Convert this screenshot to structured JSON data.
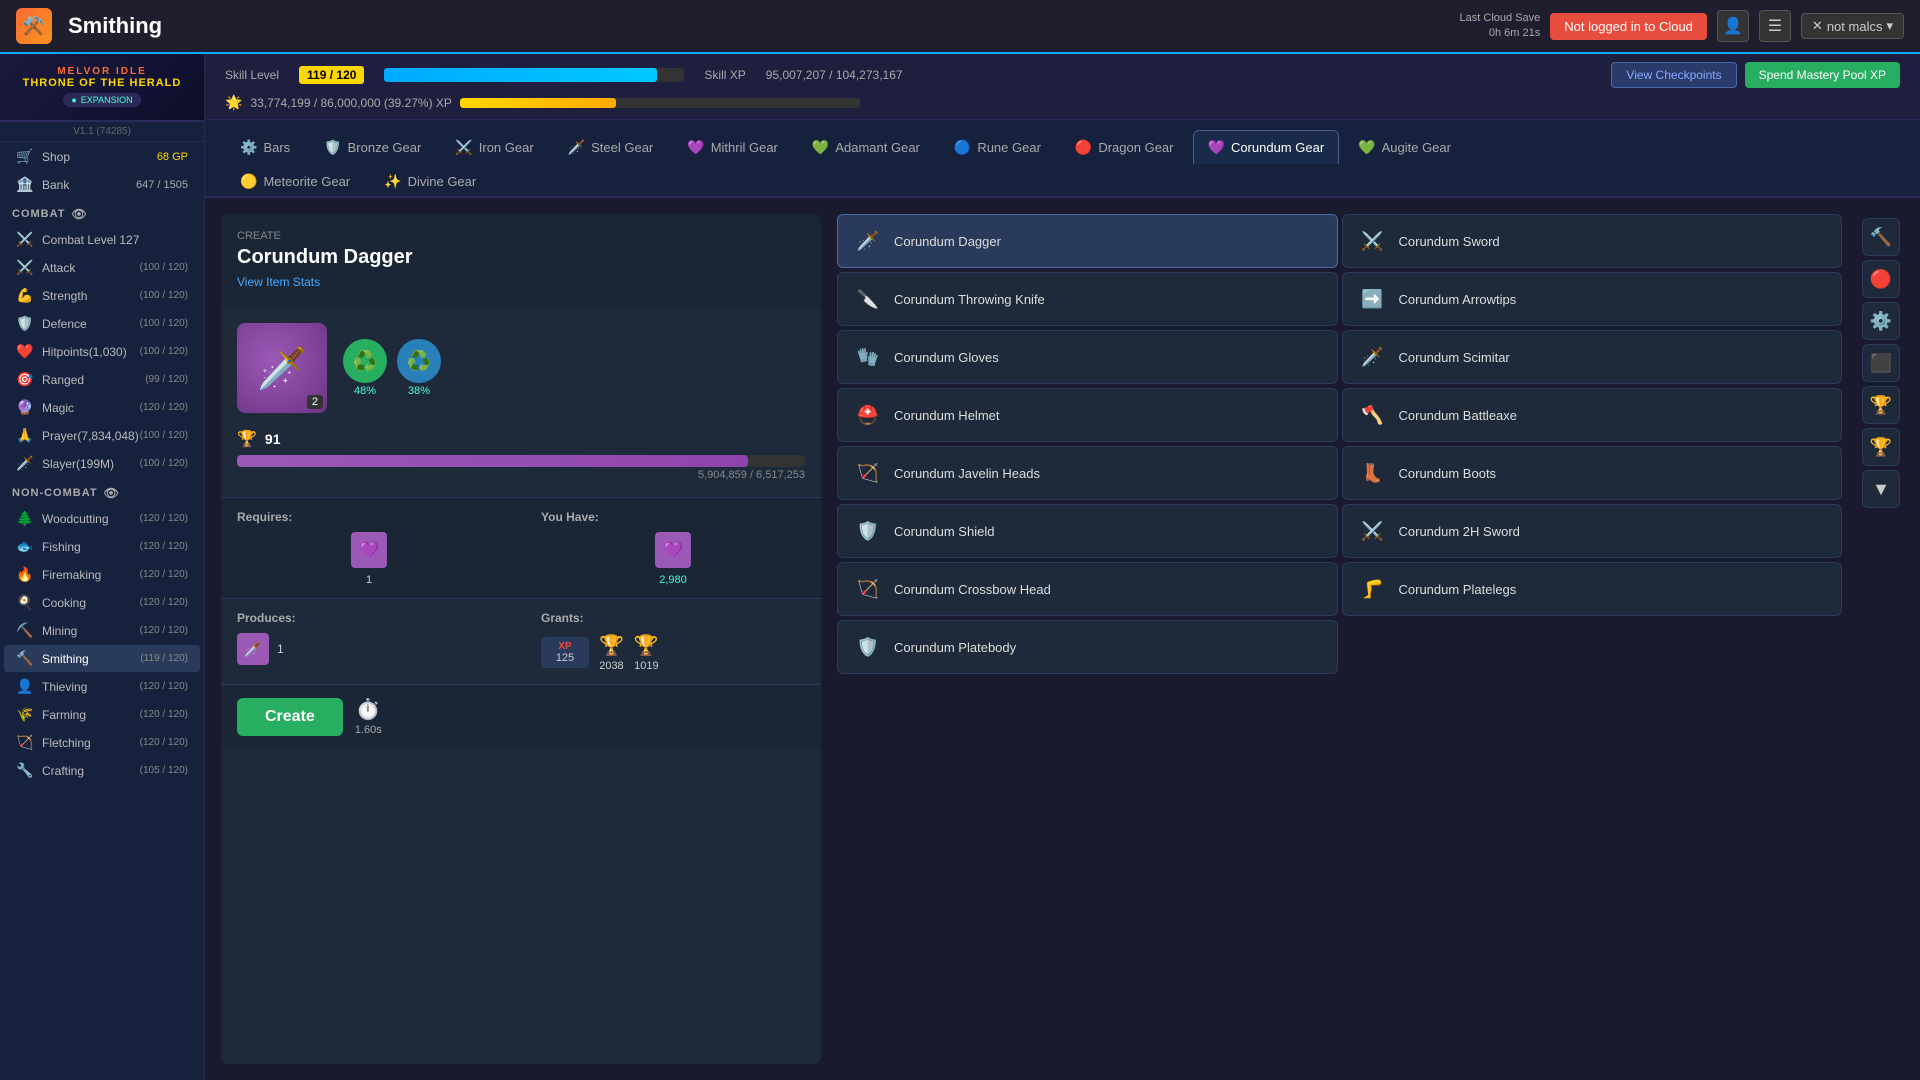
{
  "topbar": {
    "logo_icon": "🔥",
    "title": "Smithing",
    "cloud_save_label": "Last Cloud Save",
    "cloud_save_time": "0h 6m 21s",
    "not_logged_btn": "Not logged in to Cloud",
    "user_btn": "not malcs",
    "icon_bell": "👤",
    "icon_settings": "☰"
  },
  "skill_header": {
    "skill_level_label": "Skill Level",
    "skill_level": "119 / 120",
    "skill_xp_label": "Skill XP",
    "skill_xp": "95,007,207 / 104,273,167",
    "skill_xp_pct": 91,
    "mastery_icon": "🌟",
    "mastery_text": "33,774,199 / 86,000,000 (39.27%) XP",
    "mastery_pct": 39,
    "view_checkpoints": "View Checkpoints",
    "spend_mastery": "Spend Mastery Pool XP"
  },
  "tabs": {
    "row1": [
      {
        "id": "bars",
        "label": "Bars",
        "icon": "⚙️"
      },
      {
        "id": "bronze",
        "label": "Bronze Gear",
        "icon": "🛡️"
      },
      {
        "id": "iron",
        "label": "Iron Gear",
        "icon": "⚔️"
      },
      {
        "id": "steel",
        "label": "Steel Gear",
        "icon": "🗡️"
      },
      {
        "id": "mithril",
        "label": "Mithril Gear",
        "icon": "💜"
      },
      {
        "id": "adamant",
        "label": "Adamant Gear",
        "icon": "💚"
      },
      {
        "id": "rune",
        "label": "Rune Gear",
        "icon": "🔵"
      },
      {
        "id": "dragon",
        "label": "Dragon Gear",
        "icon": "🔴"
      },
      {
        "id": "corundum",
        "label": "Corundum Gear",
        "icon": "💜"
      },
      {
        "id": "augite",
        "label": "Augite Gear",
        "icon": "💚"
      }
    ],
    "row2": [
      {
        "id": "meteorite",
        "label": "Meteorite Gear",
        "icon": "🟡"
      },
      {
        "id": "divine",
        "label": "Divine Gear",
        "icon": "✨"
      }
    ],
    "active": "corundum"
  },
  "craft_panel": {
    "create_label": "Create",
    "item_name": "Corundum Dagger",
    "view_stats": "View Item Stats",
    "item_icon": "🗡️",
    "item_qty": "2",
    "recycle_pct1": "48%",
    "recycle_pct2": "38%",
    "mastery_score": "91",
    "progress_val": "5,904,859 / 6,517,253",
    "requires_label": "Requires:",
    "you_have_label": "You Have:",
    "req_mat_icon": "💜",
    "req_mat_count": "1",
    "have_mat_count": "2,980",
    "produces_label": "Produces:",
    "grants_label": "Grants:",
    "prod_icon": "🗡️",
    "prod_count": "1",
    "xp_label": "XP",
    "xp_val": "125",
    "trophy1_val": "2038",
    "trophy2_val": "1019",
    "create_btn": "Create",
    "time_val": "1.60s"
  },
  "item_grid": [
    {
      "id": "corundum-dagger",
      "name": "Corundum Dagger",
      "icon": "🗡️",
      "active": true
    },
    {
      "id": "corundum-sword",
      "name": "Corundum Sword",
      "icon": "⚔️",
      "active": false
    },
    {
      "id": "corundum-throwing-knife",
      "name": "Corundum Throwing Knife",
      "icon": "🔪",
      "active": false
    },
    {
      "id": "corundum-arrowtips",
      "name": "Corundum Arrowtips",
      "icon": "➡️",
      "active": false
    },
    {
      "id": "corundum-gloves",
      "name": "Corundum Gloves",
      "icon": "🧤",
      "active": false
    },
    {
      "id": "corundum-scimitar",
      "name": "Corundum Scimitar",
      "icon": "🗡️",
      "active": false
    },
    {
      "id": "corundum-helmet",
      "name": "Corundum Helmet",
      "icon": "⛑️",
      "active": false
    },
    {
      "id": "corundum-battleaxe",
      "name": "Corundum Battleaxe",
      "icon": "🪓",
      "active": false
    },
    {
      "id": "corundum-javelin-heads",
      "name": "Corundum Javelin Heads",
      "icon": "🏹",
      "active": false
    },
    {
      "id": "corundum-boots",
      "name": "Corundum Boots",
      "icon": "👢",
      "active": false
    },
    {
      "id": "corundum-shield",
      "name": "Corundum Shield",
      "icon": "🛡️",
      "active": false
    },
    {
      "id": "corundum-2h-sword",
      "name": "Corundum 2H Sword",
      "icon": "⚔️",
      "active": false
    },
    {
      "id": "corundum-crossbow-head",
      "name": "Corundum Crossbow Head",
      "icon": "🏹",
      "active": false
    },
    {
      "id": "corundum-platelegs",
      "name": "Corundum Platelegs",
      "icon": "🦵",
      "active": false
    },
    {
      "id": "corundum-platebody",
      "name": "Corundum Platebody",
      "icon": "🛡️",
      "active": false
    }
  ],
  "sidebar": {
    "game_title": "MELVOR IDLE",
    "expansion_title": "THRONE OF THE HERALD",
    "expansion_label": "EXPANSION",
    "version": "V1.1 (74285)",
    "shop_label": "Shop",
    "shop_gp": "68 GP",
    "bank_label": "Bank",
    "bank_val": "647 / 1505",
    "combat_label": "COMBAT",
    "combat_level": "Combat Level 127",
    "skills_combat": [
      {
        "icon": "⚔️",
        "label": "Attack",
        "level": "(100 / 120)"
      },
      {
        "icon": "💪",
        "label": "Strength",
        "level": "(100 / 120)"
      },
      {
        "icon": "🛡️",
        "label": "Defence",
        "level": "(100 / 120)"
      },
      {
        "icon": "❤️",
        "label": "Hitpoints(1,030)",
        "level": "(100 / 120)"
      },
      {
        "icon": "🎯",
        "label": "Ranged",
        "level": "(99 / 120)"
      },
      {
        "icon": "🔮",
        "label": "Magic",
        "level": "(120 / 120)"
      },
      {
        "icon": "🙏",
        "label": "Prayer(7,834,048)",
        "level": "(100 / 120)"
      },
      {
        "icon": "🗡️",
        "label": "Slayer(199M)",
        "level": "(100 / 120)"
      }
    ],
    "noncombat_label": "NON-COMBAT",
    "skills_noncombat": [
      {
        "icon": "🌲",
        "label": "Woodcutting",
        "level": "(120 / 120)"
      },
      {
        "icon": "🐟",
        "label": "Fishing",
        "level": "(120 / 120)"
      },
      {
        "icon": "🔥",
        "label": "Firemaking",
        "level": "(120 / 120)"
      },
      {
        "icon": "🍳",
        "label": "Cooking",
        "level": "(120 / 120)"
      },
      {
        "icon": "⛏️",
        "label": "Mining",
        "level": "(120 / 120)"
      },
      {
        "icon": "🔨",
        "label": "Smithing",
        "level": "(119 / 120)"
      },
      {
        "icon": "👤",
        "label": "Thieving",
        "level": "(120 / 120)"
      },
      {
        "icon": "🌾",
        "label": "Farming",
        "level": "(120 / 120)"
      },
      {
        "icon": "🏹",
        "label": "Fletching",
        "level": "(120 / 120)"
      },
      {
        "icon": "🔧",
        "label": "Crafting",
        "level": "(105 / 120)"
      }
    ]
  },
  "right_panel_buttons": [
    {
      "id": "btn1",
      "icon": "🔨"
    },
    {
      "id": "btn2",
      "icon": "🔴"
    },
    {
      "id": "btn3",
      "icon": "⚙️"
    },
    {
      "id": "btn4",
      "icon": "⬛"
    },
    {
      "id": "btn5",
      "icon": "🏆"
    },
    {
      "id": "btn6",
      "icon": "🏆"
    },
    {
      "id": "btn7",
      "icon": "▼"
    }
  ]
}
